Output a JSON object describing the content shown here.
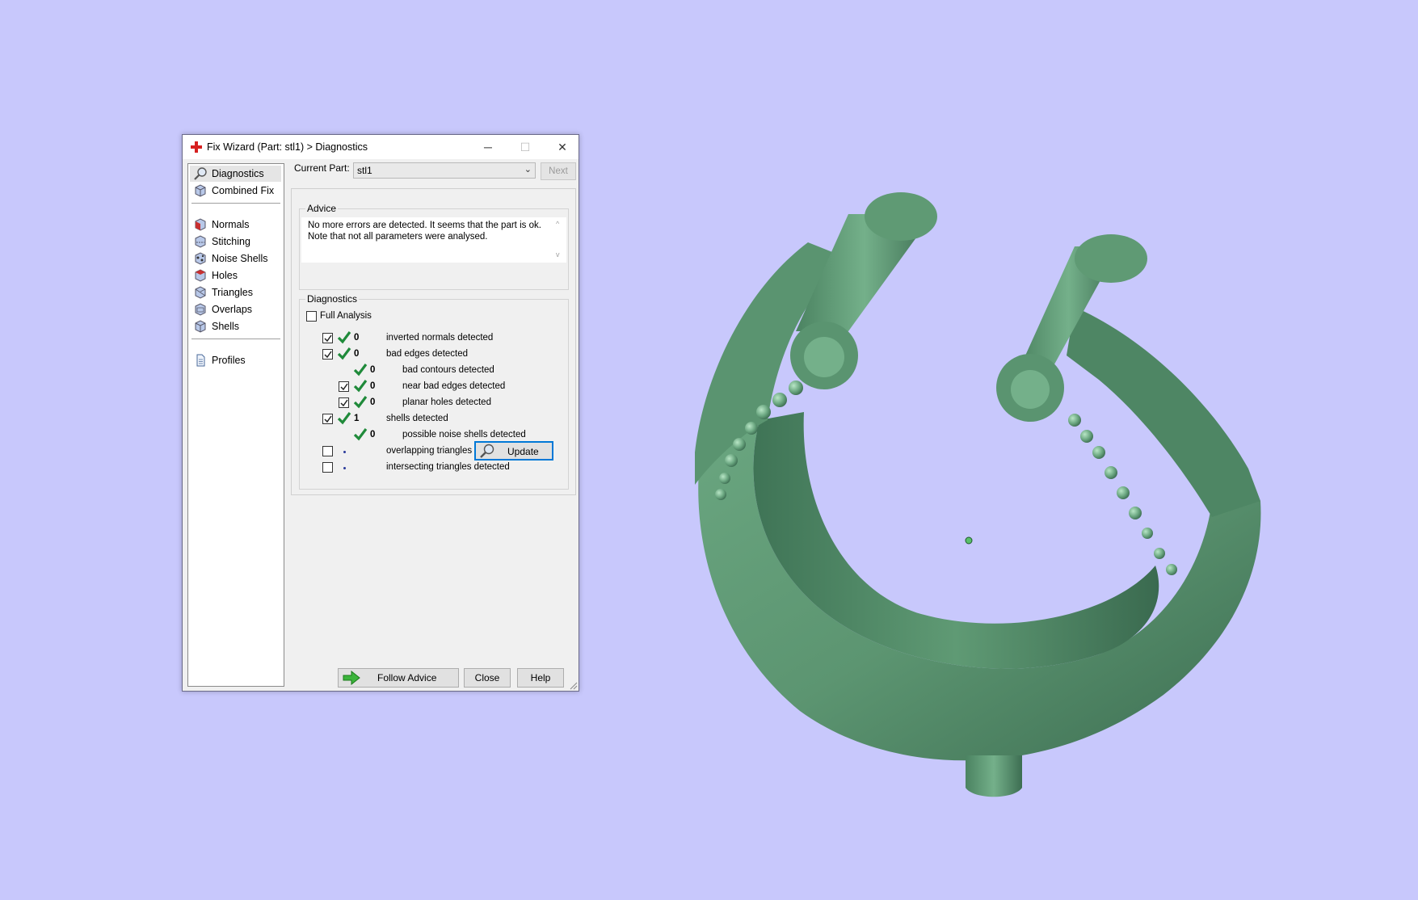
{
  "window": {
    "title": "Fix Wizard (Part: stl1) > Diagnostics",
    "minimize_glyph": "─",
    "maximize_glyph": "☐",
    "close_glyph": "✕"
  },
  "nav": {
    "items": [
      {
        "label": "Diagnostics",
        "icon": "magnifier-icon",
        "selected": true
      },
      {
        "label": "Combined Fix",
        "icon": "cube-icon"
      },
      {
        "label": "Normals",
        "icon": "normals-cube-icon"
      },
      {
        "label": "Stitching",
        "icon": "stitching-cube-icon"
      },
      {
        "label": "Noise Shells",
        "icon": "noise-shells-icon"
      },
      {
        "label": "Holes",
        "icon": "holes-cube-icon"
      },
      {
        "label": "Triangles",
        "icon": "triangles-cube-icon"
      },
      {
        "label": "Overlaps",
        "icon": "overlaps-cube-icon"
      },
      {
        "label": "Shells",
        "icon": "shells-cube-icon"
      },
      {
        "label": "Profiles",
        "icon": "document-icon"
      }
    ]
  },
  "part": {
    "label": "Current Part:",
    "value": "stl1",
    "next_label": "Next"
  },
  "advice": {
    "title": "Advice",
    "line1": "No more errors are detected. It seems that the part is ok.",
    "line2": "Note that not all parameters were analysed.",
    "scroll_up": "^",
    "scroll_down": "v"
  },
  "diagnostics": {
    "title": "Diagnostics",
    "full_analysis_label": "Full Analysis",
    "full_analysis_checked": false,
    "rows": [
      {
        "checkbox": true,
        "checked": true,
        "status": "ok",
        "count": "0",
        "label": "inverted normals detected",
        "indent": 0
      },
      {
        "checkbox": true,
        "checked": true,
        "status": "ok",
        "count": "0",
        "label": "bad edges detected",
        "indent": 0
      },
      {
        "checkbox": false,
        "checked": false,
        "status": "ok",
        "count": "0",
        "label": "bad contours detected",
        "indent": 1
      },
      {
        "checkbox": true,
        "checked": true,
        "status": "ok",
        "count": "0",
        "label": "near bad edges detected",
        "indent": 1
      },
      {
        "checkbox": true,
        "checked": true,
        "status": "ok",
        "count": "0",
        "label": "planar holes detected",
        "indent": 1
      },
      {
        "checkbox": true,
        "checked": true,
        "status": "ok",
        "count": "1",
        "label": "shells detected",
        "indent": 0
      },
      {
        "checkbox": false,
        "checked": false,
        "status": "ok",
        "count": "0",
        "label": "possible noise shells detected",
        "indent": 1
      },
      {
        "checkbox": true,
        "checked": false,
        "status": "dot",
        "count": "",
        "label": "overlapping triangles detected",
        "indent": 0
      },
      {
        "checkbox": true,
        "checked": false,
        "status": "dot",
        "count": "",
        "label": "intersecting triangles detected",
        "indent": 0
      }
    ],
    "update_label": "Update"
  },
  "buttons": {
    "follow_advice": "Follow Advice",
    "close": "Close",
    "help": "Help"
  },
  "colors": {
    "viewport_bg": "#c8c8fc",
    "model_green": "#5f9a74",
    "check_green": "#1f8a3a"
  }
}
